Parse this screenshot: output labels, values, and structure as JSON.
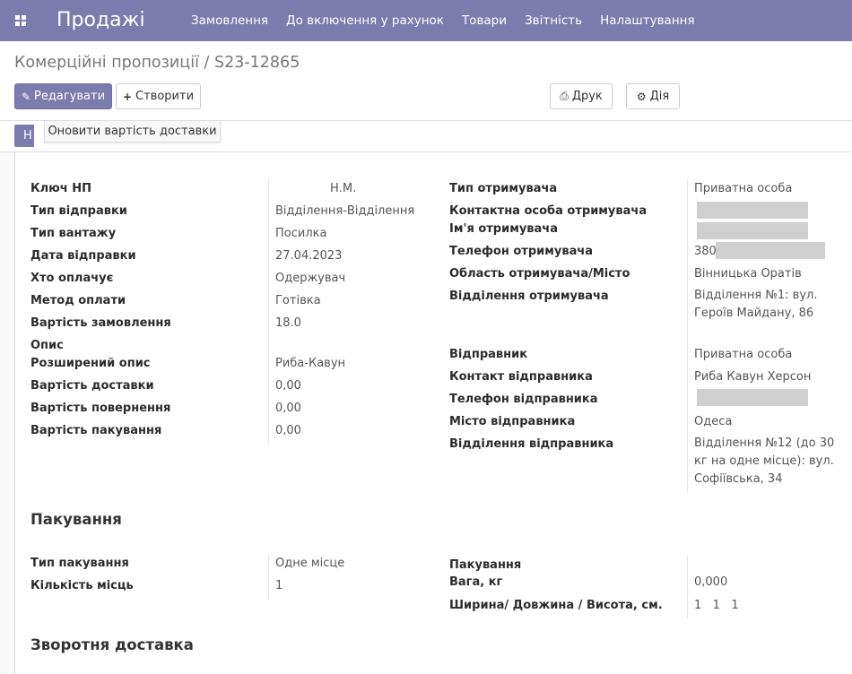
{
  "navbar": {
    "apps_icon": "apps-grid-icon",
    "brand": "Продажі",
    "menu": [
      "Замовлення",
      "До включення у рахунок",
      "Товари",
      "Звітність",
      "Налаштування"
    ]
  },
  "breadcrumb": "Комерційні пропозиції / S23-12865",
  "toolbar": {
    "edit_label": "Редагувати",
    "edit_icon": "pencil-icon",
    "create_label": "Створити",
    "create_icon": "plus-icon",
    "print_label": "Друк",
    "print_icon": "printer-icon",
    "action_label": "Дія",
    "action_icon": "gear-icon"
  },
  "statusbar": {
    "button_label": "Н"
  },
  "tooltip": "Оновити вартість доставки",
  "form": {
    "left_fields": [
      {
        "label": "Ключ НП",
        "value": "Н.М."
      },
      {
        "label": "Тип відправки",
        "value": "Відділення-Відділення"
      },
      {
        "label": "Тип вантажу",
        "value": "Посилка"
      },
      {
        "label": "Дата відправки",
        "value": "27.04.2023"
      },
      {
        "label": "Хто оплачує",
        "value": "Одержувач"
      },
      {
        "label": "Метод оплати",
        "value": "Готівка"
      },
      {
        "label": "Вартість замовлення",
        "value": "18.0"
      },
      {
        "label": "Опис",
        "value": ""
      },
      {
        "label": "Розширений опис",
        "value": "Риба-Кавун"
      },
      {
        "label": "Вартість доставки",
        "value": "0,00"
      },
      {
        "label": "Вартість повернення",
        "value": "0,00"
      },
      {
        "label": "Вартість пакування",
        "value": "0,00"
      }
    ],
    "right_fields": {
      "recipient_type_label": "Тип отримувача",
      "recipient_type_value": "Приватна особа",
      "recipient_contact_label": "Контактна особа отримувача",
      "recipient_name_label": "Ім'я отримувача",
      "recipient_phone_label": "Телефон отримувача",
      "recipient_phone_prefix": "380",
      "recipient_region_label": "Область отримувача/Місто",
      "recipient_region_value": "Вінницька Оратів",
      "recipient_branch_label": "Відділення отримувача",
      "recipient_branch_value": "Відділення №1: вул. Героїв Майдану, 86",
      "sender_label": "Відправник",
      "sender_value": "Приватна особа",
      "sender_contact_label": "Контакт відправника",
      "sender_contact_value": "Риба Кавун Херсон",
      "sender_phone_label": "Телефон відправника",
      "sender_city_label": "Місто відправника",
      "sender_city_value": "Одеса",
      "sender_branch_label": "Відділення відправника",
      "sender_branch_value": "Відділення №12 (до 30 кг на одне місце): вул. Софіївська, 34"
    }
  },
  "packing": {
    "title": "Пакування",
    "type_label": "Тип пакування",
    "type_value": "Одне місце",
    "count_label": "Кількість місць",
    "count_value": "1",
    "packing_label": "Пакування",
    "weight_label": "Вага, кг",
    "weight_value": "0,000",
    "dims_label": "Ширина/ Довжина / Висота, см.",
    "dims_value": "1   1   1"
  },
  "return_section": {
    "title": "Зворотня доставка"
  }
}
